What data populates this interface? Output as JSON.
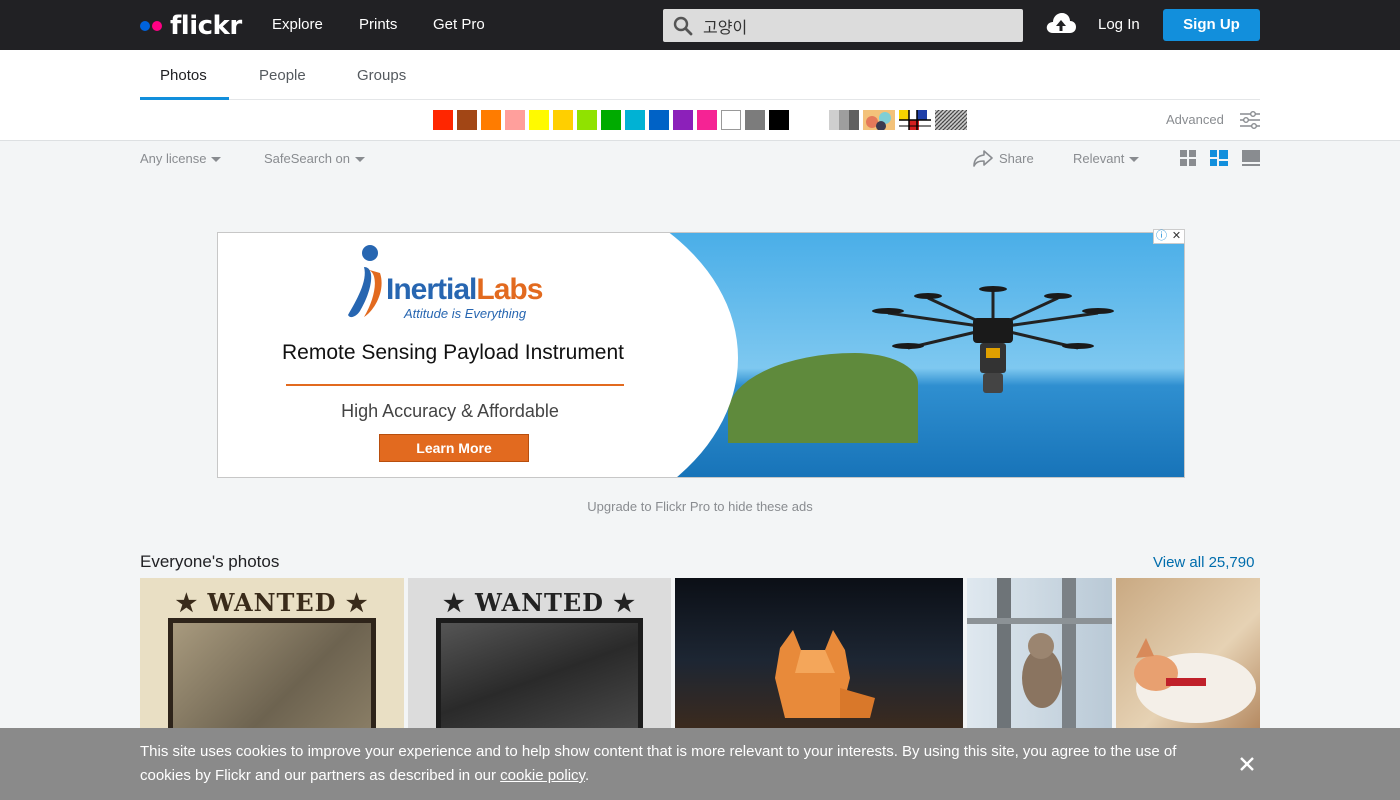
{
  "nav": {
    "brand": "flickr",
    "links": [
      "Explore",
      "Prints",
      "Get Pro"
    ],
    "search_value": "고양이",
    "login": "Log In",
    "signup": "Sign Up",
    "brand_colors": {
      "blue": "#0063dc",
      "pink": "#ff0084"
    }
  },
  "tabs": [
    {
      "label": "Photos",
      "active": true
    },
    {
      "label": "People",
      "active": false
    },
    {
      "label": "Groups",
      "active": false
    }
  ],
  "color_filters": [
    "#ff2600",
    "#a24615",
    "#ff7c00",
    "#ff9f9c",
    "#fffa00",
    "#ffcf00",
    "#90e200",
    "#00ab00",
    "#00b2d4",
    "#0062c6",
    "#8c20ba",
    "#f52394",
    "#ffffff",
    "#7c7c7c",
    "#000000"
  ],
  "style_filters": [
    "black-and-white",
    "shallow-depth-of-field",
    "minimalist",
    "patterns"
  ],
  "advanced_label": "Advanced",
  "filters": {
    "license": "Any license",
    "safesearch": "SafeSearch on",
    "share": "Share",
    "sort": "Relevant",
    "view_modes": [
      "grid-small-icon",
      "justified-icon",
      "large-icon"
    ],
    "active_view": "justified-icon"
  },
  "ad": {
    "brand_main": "Inertial",
    "brand_accent": "Labs",
    "tagline": "Attitude is Everything",
    "headline": "Remote Sensing Payload Instrument",
    "subline": "High Accuracy & Affordable",
    "cta": "Learn More",
    "accent_color": "#e26a1f",
    "brand_color": "#2766b1"
  },
  "upgrade_text": "Upgrade to Flickr Pro to hide these ads",
  "section": {
    "title": "Everyone's photos",
    "view_all": "View all 25,790"
  },
  "photos": [
    {
      "type": "wanted-poster",
      "banner": "★ WANTED ★"
    },
    {
      "type": "wanted-poster",
      "banner": "★ WANTED ★"
    },
    {
      "type": "origami-cat"
    },
    {
      "type": "cat-on-railing"
    },
    {
      "type": "sleeping-cat"
    }
  ],
  "cookie": {
    "text": "This site uses cookies to improve your experience and to help show content that is more relevant to your interests. By using this site, you agree to the use of cookies by Flickr and our partners as described in our ",
    "link": "cookie policy",
    "end": "."
  }
}
